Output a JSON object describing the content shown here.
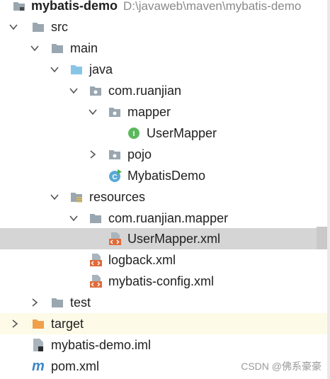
{
  "project": {
    "name": "mybatis-demo",
    "path": "D:\\javaweb\\maven\\mybatis-demo"
  },
  "tree": [
    {
      "label": "src",
      "icon": "folder-icon",
      "expanded": true
    },
    {
      "label": "main",
      "icon": "folder-icon",
      "expanded": true
    },
    {
      "label": "java",
      "icon": "source-folder-icon",
      "expanded": true
    },
    {
      "label": "com.ruanjian",
      "icon": "package-icon",
      "expanded": true
    },
    {
      "label": "mapper",
      "icon": "package-icon",
      "expanded": true
    },
    {
      "label": "UserMapper",
      "icon": "interface-icon",
      "icon_letter": "I"
    },
    {
      "label": "pojo",
      "icon": "package-icon",
      "expanded": false
    },
    {
      "label": "MybatisDemo",
      "icon": "class-icon",
      "icon_letter": "C"
    },
    {
      "label": "resources",
      "icon": "resources-folder-icon",
      "expanded": true
    },
    {
      "label": "com.ruanjian.mapper",
      "icon": "folder-icon",
      "expanded": true
    },
    {
      "label": "UserMapper.xml",
      "icon": "xml-file-icon",
      "selected": true
    },
    {
      "label": "logback.xml",
      "icon": "xml-file-icon"
    },
    {
      "label": "mybatis-config.xml",
      "icon": "xml-file-icon"
    },
    {
      "label": "test",
      "icon": "folder-icon",
      "expanded": false
    },
    {
      "label": "target",
      "icon": "excluded-folder-icon",
      "expanded": false
    },
    {
      "label": "mybatis-demo.iml",
      "icon": "iml-file-icon"
    },
    {
      "label": "pom.xml",
      "icon": "maven-icon",
      "icon_letter": "m"
    }
  ],
  "watermark": "CSDN @佛系豪豪",
  "colors": {
    "folder": "#9aa7b0",
    "source_folder": "#87c5e6",
    "target_folder": "#f0a04b",
    "xml_orange": "#e06b3a",
    "interface_green": "#5cb85c",
    "class_blue": "#5aa9d6",
    "maven_blue": "#3d86c6",
    "selection": "#d5d5d5",
    "excluded_bg": "#fdfbe8"
  }
}
